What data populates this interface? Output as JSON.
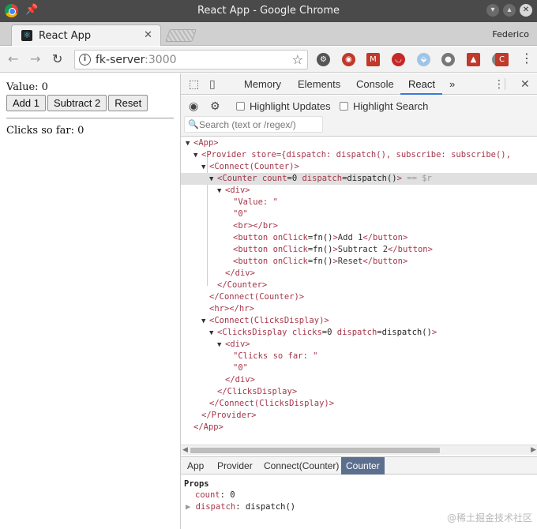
{
  "window": {
    "title": "React App - Google Chrome"
  },
  "tab": {
    "label": "React App"
  },
  "profile": {
    "name": "Federico"
  },
  "omnibox": {
    "host": "fk-server",
    "port": ":3000"
  },
  "page": {
    "value_line": "Value: 0",
    "buttons": [
      "Add 1",
      "Subtract 2",
      "Reset"
    ],
    "clicks_line": "Clicks so far: 0"
  },
  "devtools": {
    "tabs": [
      "Memory",
      "Elements",
      "Console",
      "React"
    ],
    "more": "»",
    "react": {
      "highlight_updates": "Highlight Updates",
      "highlight_search": "Highlight Search",
      "search_placeholder": "Search (text or /regex/)"
    }
  },
  "tree": {
    "app_open": "<App>",
    "provider_open": "<Provider store={dispatch: dispatch(), subscribe: subscribe(),",
    "connect_counter_open": "<Connect(Counter)>",
    "counter_tag": "<Counter",
    "counter_attr1": "count",
    "counter_val1": "=0 ",
    "counter_attr2": "dispatch",
    "counter_val2": "=dispatch()",
    "counter_close": ">",
    "counter_selref": " == $r",
    "div_open": "<div>",
    "value_str": "\"Value: \"",
    "zero_str": "\"0\"",
    "br": "<br></br>",
    "btn_open": "<button",
    "onclick": "onClick",
    "fn": "=fn()",
    "btn_gt": ">",
    "add_text": "Add 1",
    "sub_text": "Subtract 2",
    "reset_text": "Reset",
    "btn_close": "</button>",
    "div_close": "</div>",
    "counter_end": "</Counter>",
    "connect_counter_close": "</Connect(Counter)>",
    "hr": "<hr></hr>",
    "connect_clicks_open": "<Connect(ClicksDisplay)>",
    "clicks_tag": "<ClicksDisplay",
    "clicks_attr1": "clicks",
    "clicks_val1": "=0 ",
    "clicks_attr2": "dispatch",
    "clicks_val2": "=dispatch()",
    "clicks_gt": ">",
    "clicks_str": "\"Clicks so far: \"",
    "clicks_end": "</ClicksDisplay>",
    "connect_clicks_close": "</Connect(ClicksDisplay)>",
    "provider_close": "</Provider>",
    "app_close": "</App>"
  },
  "breadcrumbs": [
    "App",
    "Provider",
    "Connect(Counter)",
    "Counter"
  ],
  "props": {
    "title": "Props",
    "count_key": "count",
    "count_val": "0",
    "dispatch_key": "dispatch",
    "dispatch_val": "dispatch()"
  },
  "watermark": "@稀土掘金技术社区",
  "colors": {
    "accent": "#3879d9",
    "tag": "#a5364a",
    "selected_crumb": "#5b6f8e"
  }
}
